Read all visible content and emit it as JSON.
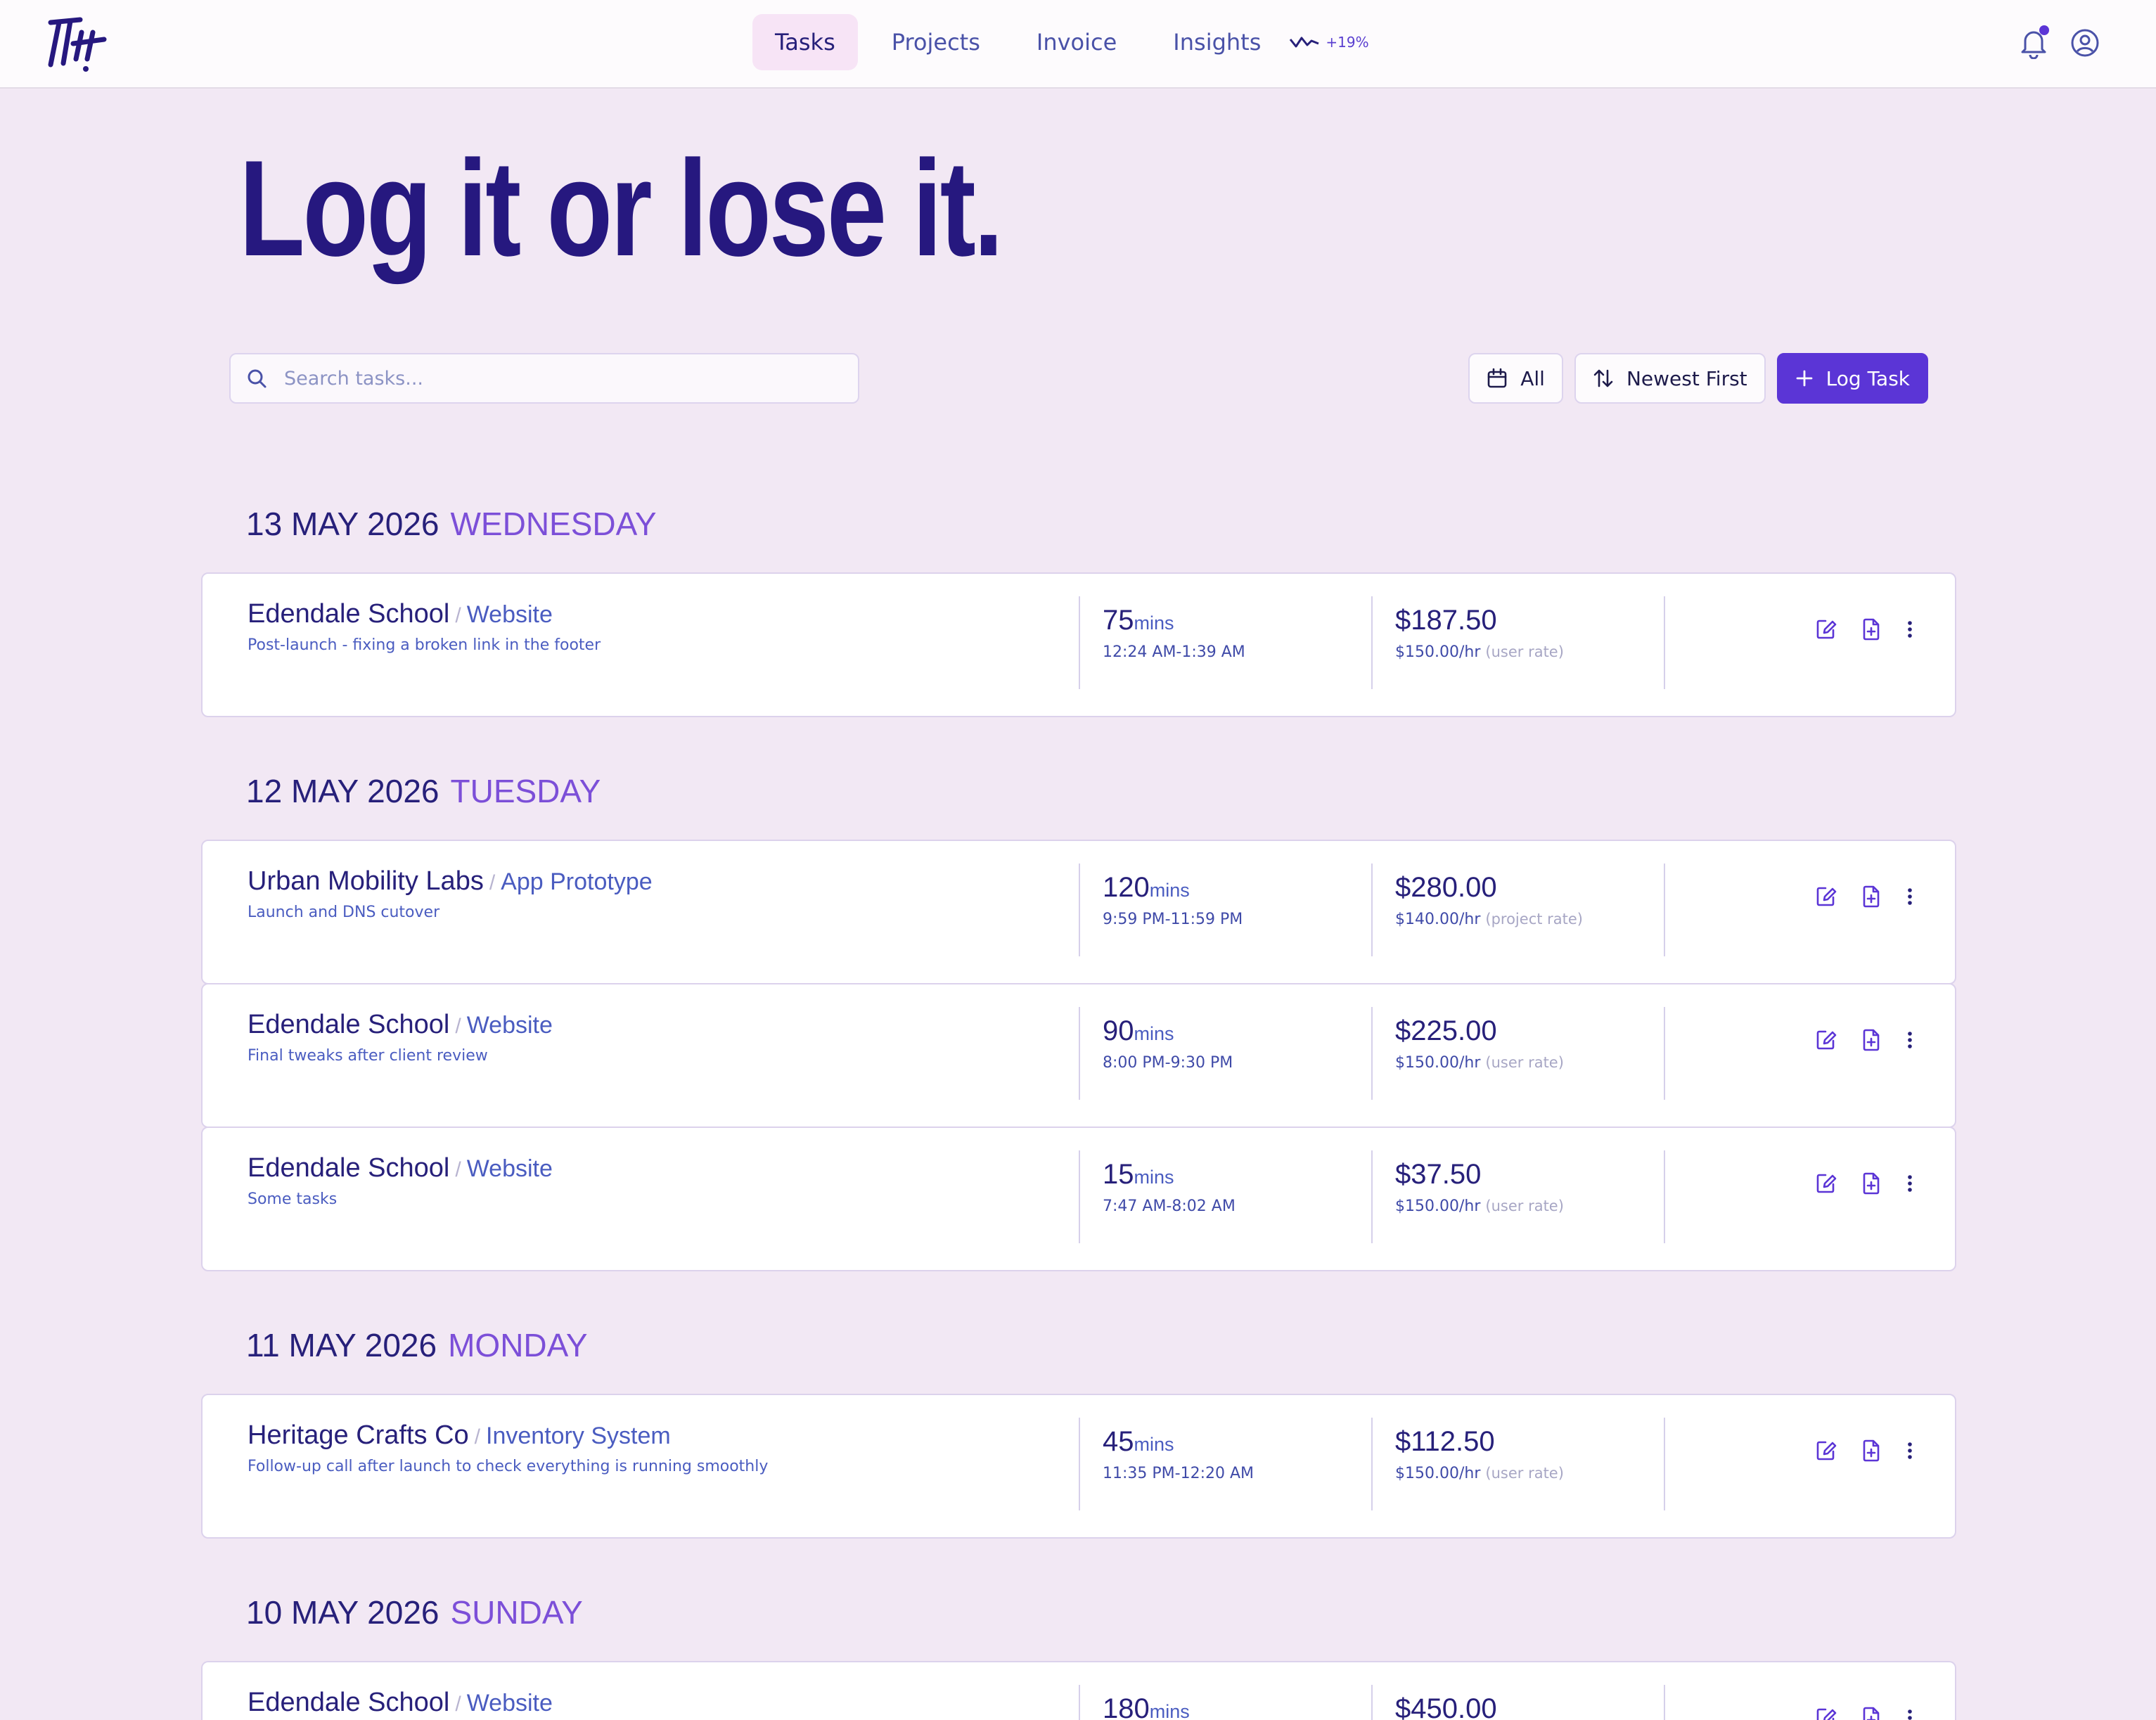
{
  "nav": {
    "items": [
      {
        "label": "Tasks",
        "active": true
      },
      {
        "label": "Projects",
        "active": false
      },
      {
        "label": "Invoice",
        "active": false
      },
      {
        "label": "Insights",
        "active": false
      }
    ],
    "insights_trend": "+19%"
  },
  "hero": {
    "title": "Log it or lose it."
  },
  "search": {
    "placeholder": "Search tasks..."
  },
  "controls": {
    "filter_label": "All",
    "sort_label": "Newest First",
    "log_label": "Log Task"
  },
  "days": [
    {
      "date": "13 MAY 2026",
      "weekday": "WEDNESDAY",
      "tasks": [
        {
          "client": "Edendale School",
          "project": "Website",
          "note": "Post-launch - fixing a broken link in the footer",
          "minutes": "75",
          "unit": "mins",
          "time": "12:24 AM-1:39 AM",
          "amount": "$187.50",
          "rate": "$150.00/hr",
          "rate_type": "(user rate)"
        }
      ]
    },
    {
      "date": "12 MAY 2026",
      "weekday": "TUESDAY",
      "tasks": [
        {
          "client": "Urban Mobility Labs",
          "project": "App Prototype",
          "note": "Launch and DNS cutover",
          "minutes": "120",
          "unit": "mins",
          "time": "9:59 PM-11:59 PM",
          "amount": "$280.00",
          "rate": "$140.00/hr",
          "rate_type": "(project rate)"
        },
        {
          "client": "Edendale School",
          "project": "Website",
          "note": "Final tweaks after client review",
          "minutes": "90",
          "unit": "mins",
          "time": "8:00 PM-9:30 PM",
          "amount": "$225.00",
          "rate": "$150.00/hr",
          "rate_type": "(user rate)"
        },
        {
          "client": "Edendale School",
          "project": "Website",
          "note": "Some tasks",
          "minutes": "15",
          "unit": "mins",
          "time": "7:47 AM-8:02 AM",
          "amount": "$37.50",
          "rate": "$150.00/hr",
          "rate_type": "(user rate)"
        }
      ]
    },
    {
      "date": "11 MAY 2026",
      "weekday": "MONDAY",
      "tasks": [
        {
          "client": "Heritage Crafts Co",
          "project": "Inventory System",
          "note": "Follow-up call after launch to check everything is running smoothly",
          "minutes": "45",
          "unit": "mins",
          "time": "11:35 PM-12:20 AM",
          "amount": "$112.50",
          "rate": "$150.00/hr",
          "rate_type": "(user rate)"
        }
      ]
    },
    {
      "date": "10 MAY 2026",
      "weekday": "SUNDAY",
      "tasks": [
        {
          "client": "Edendale School",
          "project": "Website",
          "note": "",
          "minutes": "180",
          "unit": "mins",
          "time": "",
          "amount": "$450.00",
          "rate": "",
          "rate_type": ""
        }
      ]
    }
  ]
}
